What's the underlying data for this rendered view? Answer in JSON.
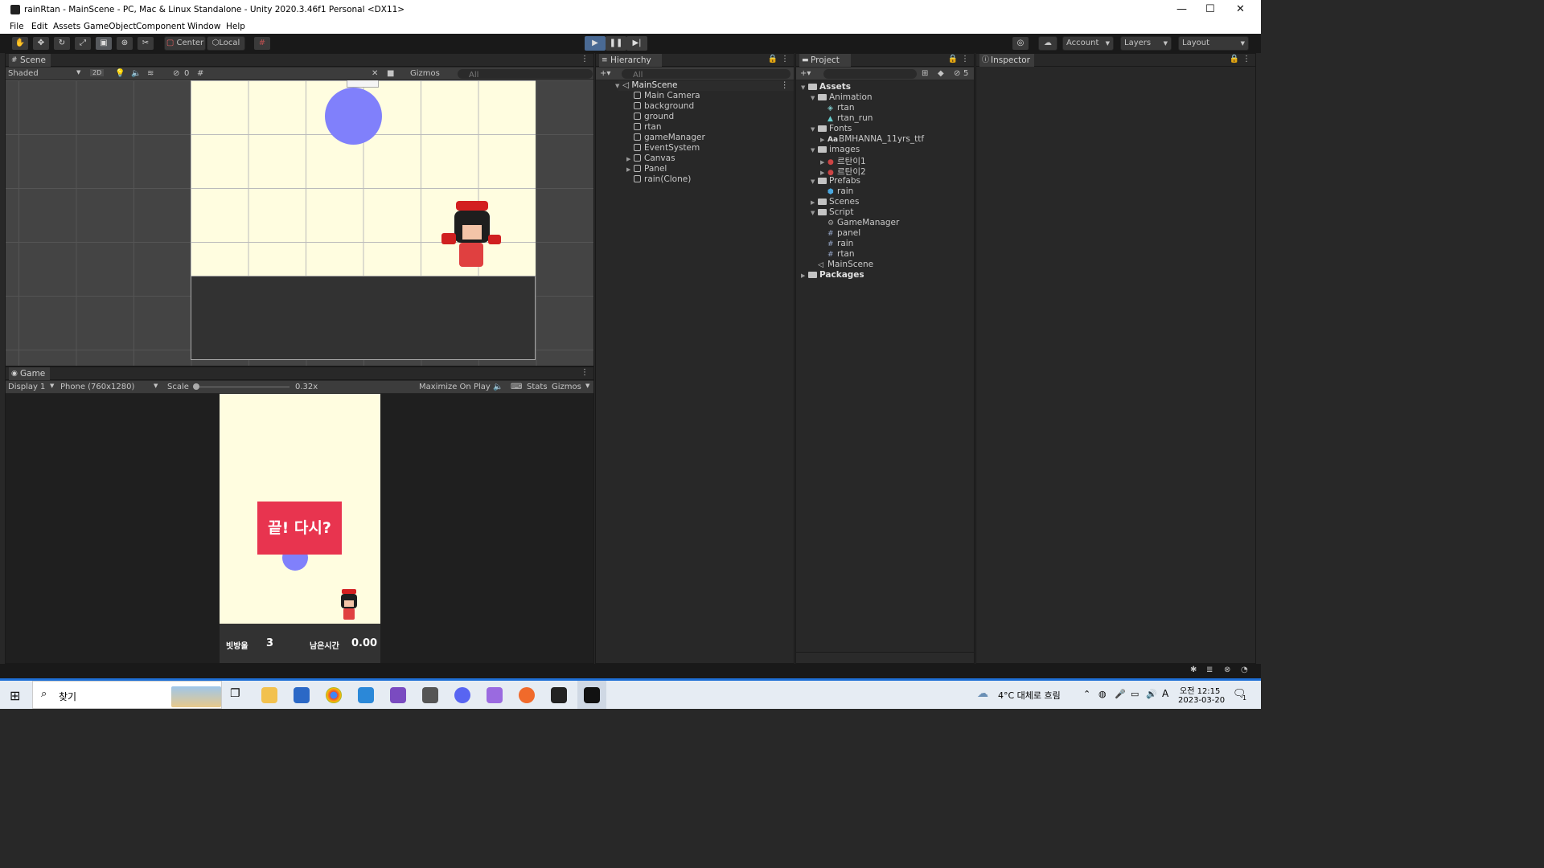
{
  "window": {
    "title": "rainRtan - MainScene - PC, Mac & Linux Standalone - Unity 2020.3.46f1 Personal <DX11>",
    "minimize": "—",
    "maximize": "☐",
    "close": "✕"
  },
  "menu": [
    "File",
    "Edit",
    "Assets",
    "GameObject",
    "Component",
    "Window",
    "Help"
  ],
  "toolbar": {
    "center_label": "Center",
    "local_label": "Local",
    "account_label": "Account",
    "layers_label": "Layers",
    "layout_label": "Layout"
  },
  "scene": {
    "tab": "Scene",
    "shading": "Shaded",
    "mode_2d": "2D",
    "hidden_count": "0",
    "gizmos": "Gizmos",
    "search_placeholder": "All",
    "colors": {
      "background": "#fffde0",
      "ground": "#323232",
      "rain": "#8080fb"
    }
  },
  "game": {
    "tab": "Game",
    "display": "Display 1",
    "resolution": "Phone (760x1280)",
    "scale_label": "Scale",
    "scale_value": "0.32x",
    "maximize": "Maximize On Play",
    "stats": "Stats",
    "gizmos": "Gizmos",
    "retry_text": "끝! 다시?",
    "rain_count_label": "빗방울",
    "rain_count_value": "3",
    "time_label": "남은시간",
    "time_value": "0.00",
    "colors": {
      "retry": "#e8344f"
    }
  },
  "hierarchy": {
    "tab": "Hierarchy",
    "search_placeholder": "All",
    "scene_name": "MainScene",
    "items": [
      {
        "label": "Main Camera",
        "exp": false
      },
      {
        "label": "background",
        "exp": false
      },
      {
        "label": "ground",
        "exp": false
      },
      {
        "label": "rtan",
        "exp": false
      },
      {
        "label": "gameManager",
        "exp": false
      },
      {
        "label": "EventSystem",
        "exp": false
      },
      {
        "label": "Canvas",
        "exp": true
      },
      {
        "label": "Panel",
        "exp": true
      },
      {
        "label": "rain(Clone)",
        "exp": false
      }
    ]
  },
  "project": {
    "tab": "Project",
    "hidden_count": "5",
    "items": [
      {
        "label": "Assets",
        "level": 0,
        "type": "folder",
        "bold": true
      },
      {
        "label": "Animation",
        "level": 1,
        "type": "folder"
      },
      {
        "label": "rtan",
        "level": 2,
        "type": "anim"
      },
      {
        "label": "rtan_run",
        "level": 2,
        "type": "clip"
      },
      {
        "label": "Fonts",
        "level": 1,
        "type": "folder"
      },
      {
        "label": "BMHANNA_11yrs_ttf",
        "level": 2,
        "type": "font",
        "icon": "Aa"
      },
      {
        "label": "images",
        "level": 1,
        "type": "folder"
      },
      {
        "label": "르탄이1",
        "level": 2,
        "type": "sprite"
      },
      {
        "label": "르탄이2",
        "level": 2,
        "type": "sprite"
      },
      {
        "label": "Prefabs",
        "level": 1,
        "type": "folder"
      },
      {
        "label": "rain",
        "level": 2,
        "type": "prefab"
      },
      {
        "label": "Scenes",
        "level": 1,
        "type": "folder"
      },
      {
        "label": "Script",
        "level": 1,
        "type": "folder"
      },
      {
        "label": "GameManager",
        "level": 2,
        "type": "gear"
      },
      {
        "label": "panel",
        "level": 2,
        "type": "script"
      },
      {
        "label": "rain",
        "level": 2,
        "type": "script"
      },
      {
        "label": "rtan",
        "level": 2,
        "type": "script"
      },
      {
        "label": "MainScene",
        "level": 1,
        "type": "scene"
      },
      {
        "label": "Packages",
        "level": 0,
        "type": "folder",
        "bold": true
      }
    ]
  },
  "inspector": {
    "tab": "Inspector"
  },
  "taskbar": {
    "search": "찾기",
    "weather": "4°C  대체로 흐림",
    "ime": "A",
    "time": "오전 12:15",
    "date": "2023-03-20",
    "notif": "1"
  }
}
